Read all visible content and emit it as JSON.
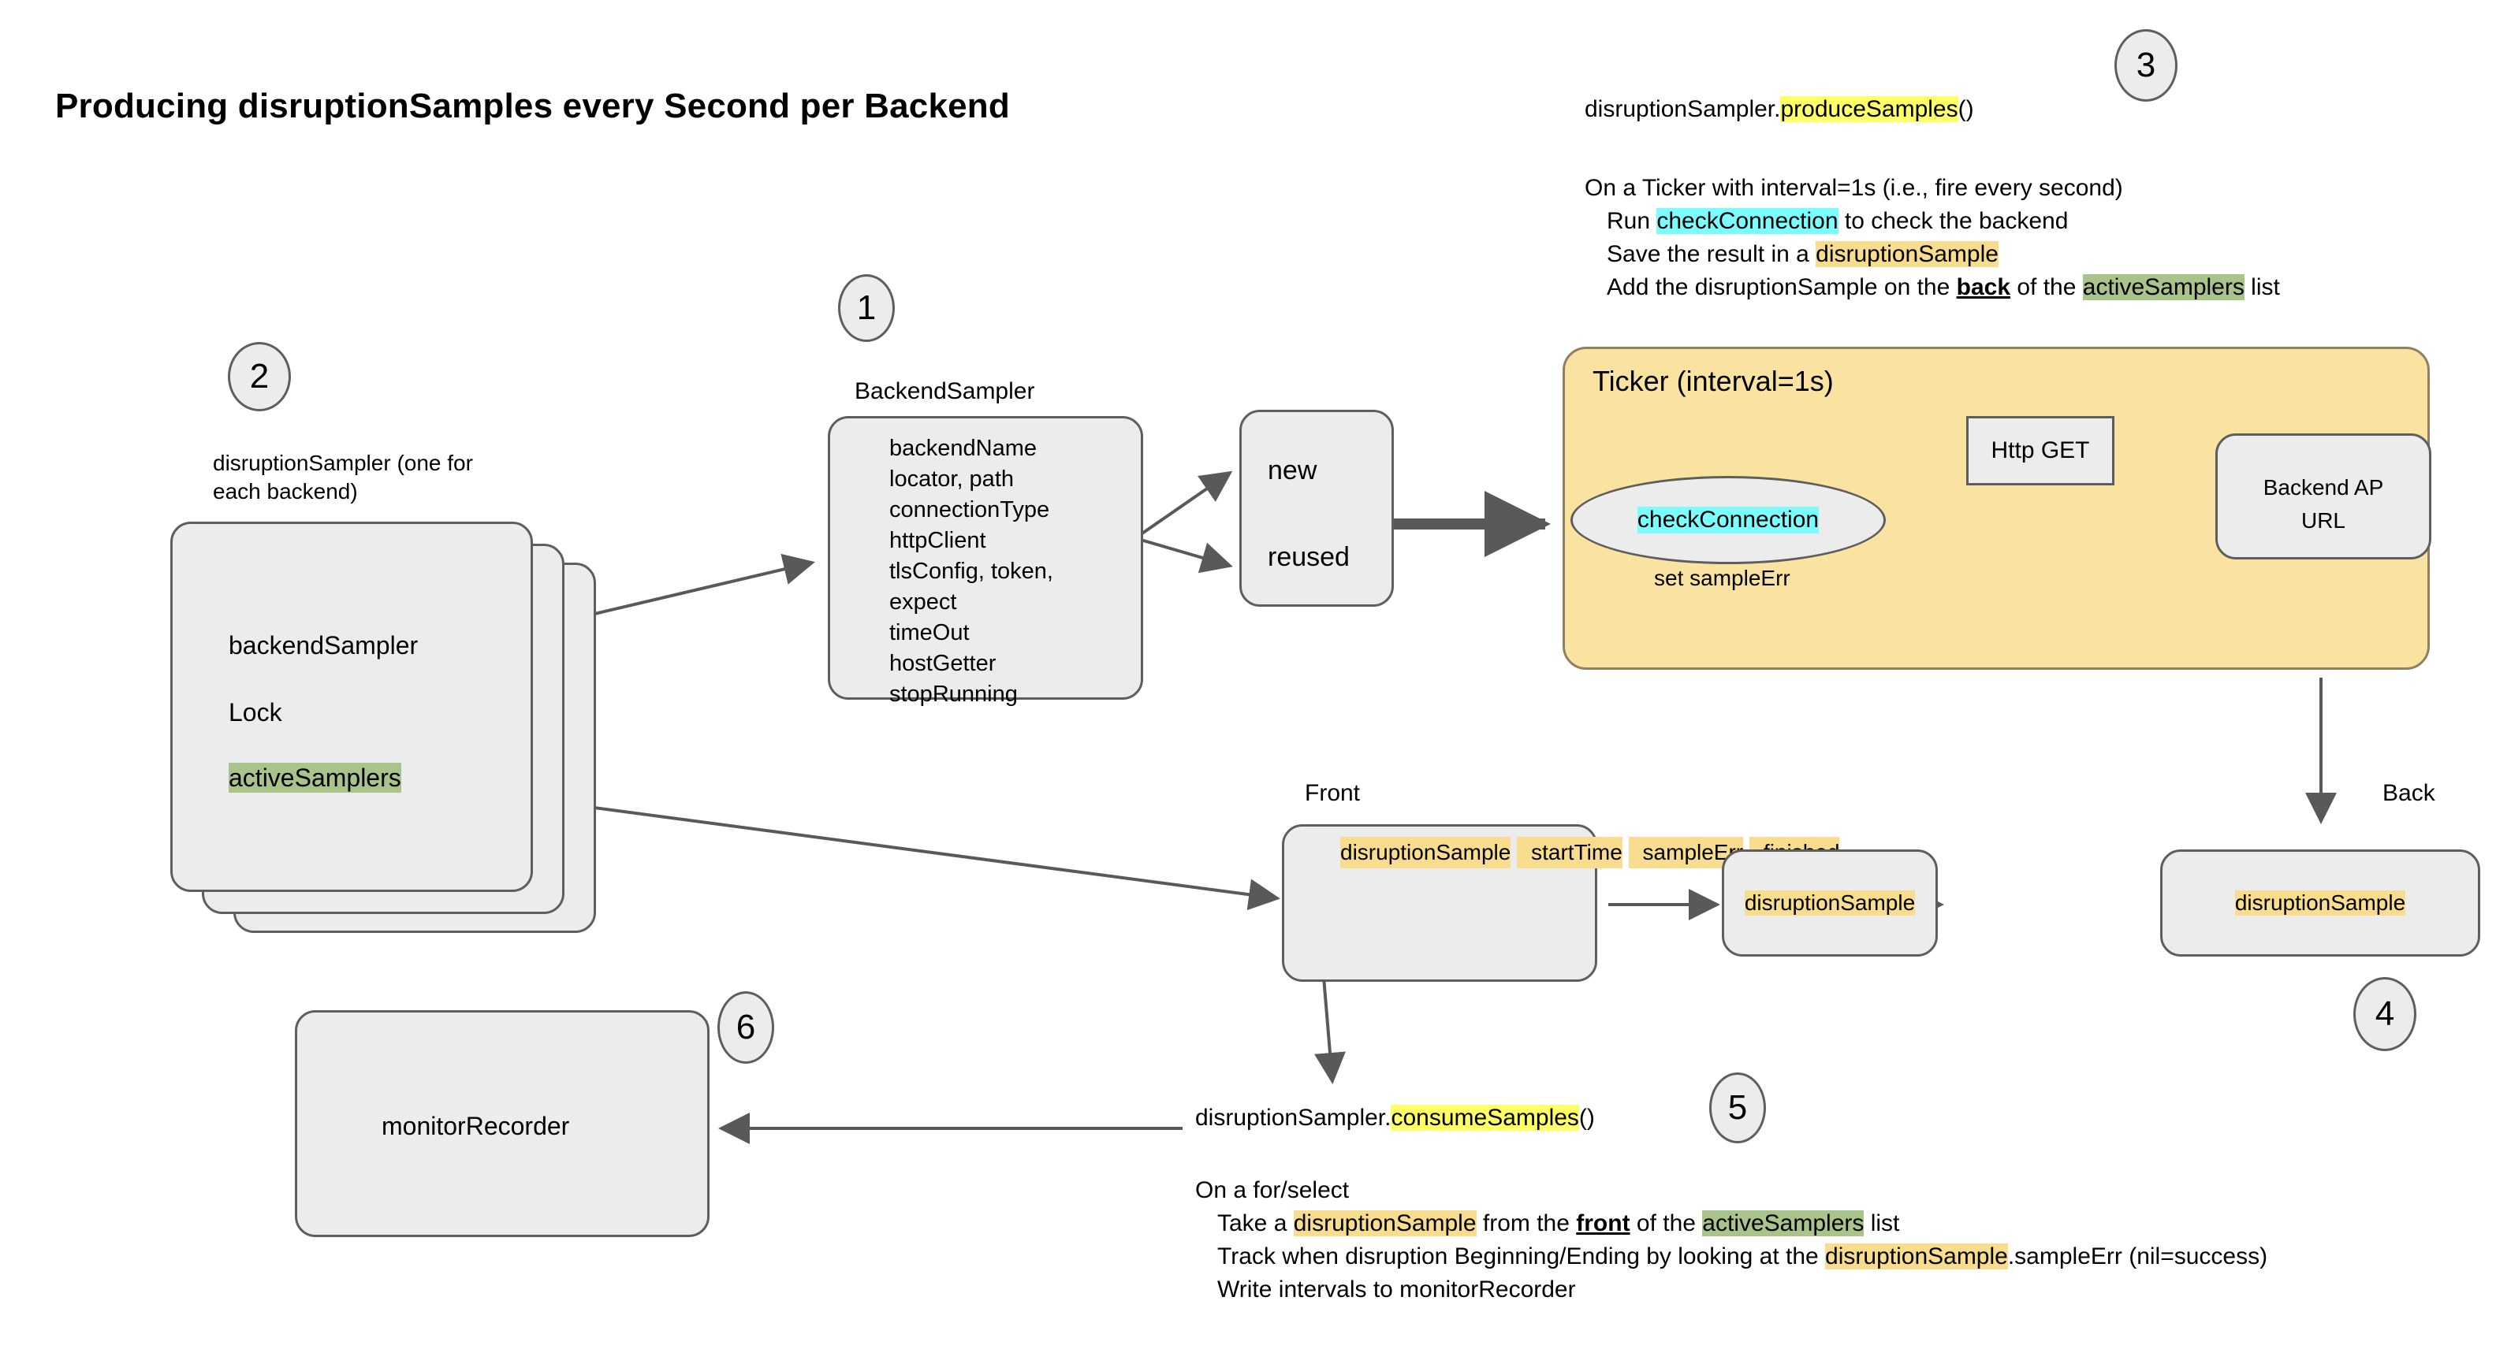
{
  "title": "Producing disruptionSamples every Second per Backend",
  "markers": {
    "one": "1",
    "two": "2",
    "three": "3",
    "four": "4",
    "five": "5",
    "six": "6"
  },
  "produce_note": {
    "call_prefix": "disruptionSampler.",
    "call_method": "produceSamples",
    "call_suffix": "()",
    "line1": "On a Ticker with interval=1s (i.e., fire every second)",
    "line2_pre": "Run ",
    "line2_hl": "checkConnection",
    "line2_post": " to check the backend",
    "line3_pre": "Save the result in a ",
    "line3_hl": "disruptionSample",
    "line4_pre": "Add the disruptionSample on the ",
    "line4_bold": "back",
    "line4_mid": " of the ",
    "line4_hl": "activeSamplers",
    "line4_post": " list"
  },
  "consume_note": {
    "call_prefix": "disruptionSampler.",
    "call_method": "consumeSamples",
    "call_suffix": "()",
    "line1": "On a for/select",
    "line2_pre": "Take a ",
    "line2_hl1": "disruptionSample",
    "line2_mid1": " from the ",
    "line2_bold": "front",
    "line2_mid2": " of the ",
    "line2_hl2": "activeSamplers",
    "line2_post": " list",
    "line3_pre": "Track when disruption Beginning/Ending by looking at the ",
    "line3_hl": "disruptionSample",
    "line3_post": ".sampleErr (nil=success)",
    "line4": "Write intervals to monitorRecorder"
  },
  "disruption_sampler": {
    "caption_line1": "disruptionSampler (one for",
    "caption_line2": "each backend)",
    "field_backend_sampler": "backendSampler",
    "field_lock": "Lock",
    "field_active_samplers": "activeSamplers"
  },
  "backend_sampler": {
    "caption": "BackendSampler",
    "fields": [
      "backendName",
      "locator, path",
      "connectionType",
      "httpClient",
      "tlsConfig, token,",
      "expect",
      "timeOut",
      "hostGetter",
      "stopRunning"
    ]
  },
  "client_box": {
    "new": "new",
    "reused": "reused"
  },
  "ticker": {
    "title": "Ticker (interval=1s)",
    "check_connection": "checkConnection",
    "set_sample_err": "set sampleErr",
    "http_get": "Http GET",
    "backend_url_line1": "Backend AP",
    "backend_url_line2": "URL"
  },
  "queue": {
    "front_label": "Front",
    "back_label": "Back",
    "item1": {
      "name": "disruptionSample",
      "fields": [
        "startTime",
        "sampleErr",
        "finished"
      ]
    },
    "item2": {
      "name": "disruptionSample"
    },
    "item3": {
      "name": "disruptionSample"
    }
  },
  "monitor_recorder": {
    "label": "monitorRecorder"
  },
  "colors": {
    "box_fill": "#ECECEC",
    "box_stroke": "#5E5E5E",
    "ticker_fill": "#FAE3A0",
    "ticker_stroke": "#8F8063",
    "highlight_yellow": "#FFFF66",
    "highlight_orange": "#F8DD8E",
    "highlight_green": "#A9C48A",
    "highlight_cyan": "#7CFDFD",
    "arrow": "#595959"
  }
}
